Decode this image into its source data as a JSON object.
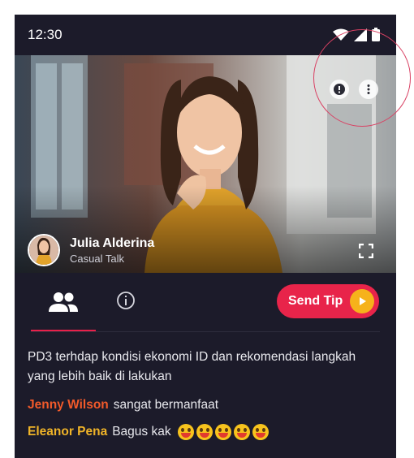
{
  "status_bar": {
    "time": "12:30"
  },
  "video": {
    "host_name": "Julia Alderina",
    "host_subtitle": "Casual Talk"
  },
  "tabs": {
    "send_tip_label": "Send Tip"
  },
  "chat": {
    "description": "PD3 terhdap kondisi ekonomi ID dan rekomendasi langkah yang lebih baik di lakukan",
    "messages": [
      {
        "user": "Jenny Wilson",
        "text": "sangat bermanfaat",
        "user_color": "#f25a2a",
        "emoji_count": 0
      },
      {
        "user": "Eleanor Pena",
        "text": "Bagus kak",
        "user_color": "#f0b428",
        "emoji_count": 5
      }
    ]
  },
  "colors": {
    "accent": "#e8244a",
    "background": "#1c1b2a",
    "coin": "#f6b21b"
  }
}
